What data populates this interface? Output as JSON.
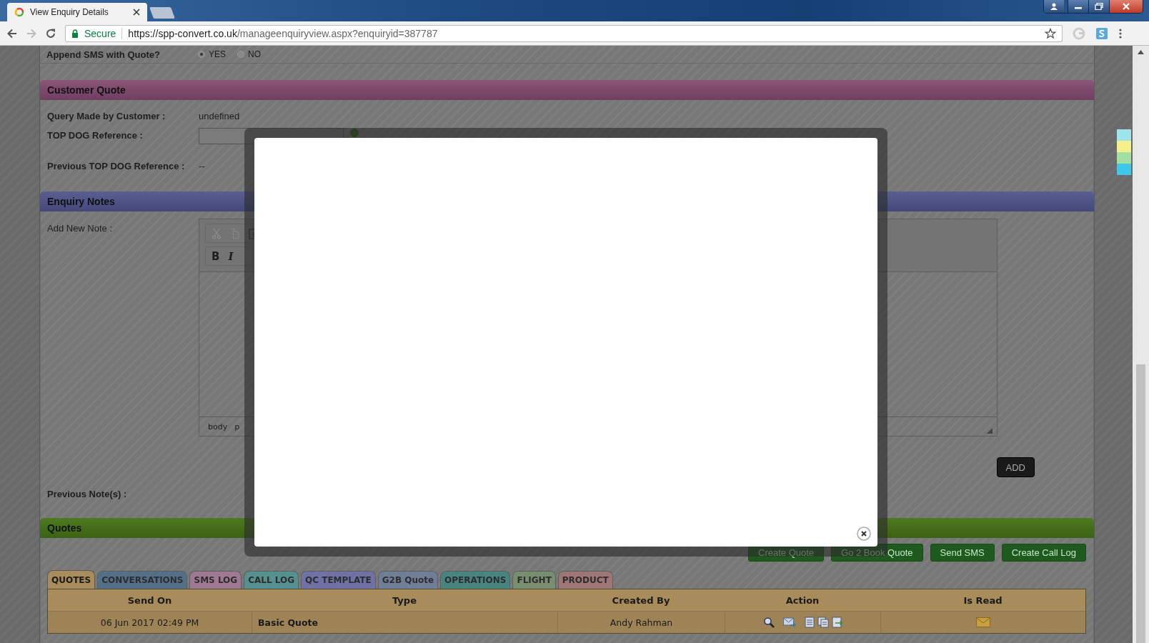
{
  "browser": {
    "tab_title": "View Enquiry Details",
    "secure_label": "Secure",
    "url_host": "https://spp-convert.co.uk",
    "url_path": "/manageenquiryview.aspx?enquiryid=387787"
  },
  "sms_option": {
    "label": "Append SMS with Quote?",
    "options": [
      {
        "label": "YES",
        "selected": true
      },
      {
        "label": "NO",
        "selected": false
      }
    ]
  },
  "customer_quote": {
    "title": "Customer Quote",
    "fields": [
      {
        "kind": "text",
        "label": "Query Made by Customer :",
        "value": "undefined"
      },
      {
        "kind": "input",
        "label": "TOP DOG Reference :"
      },
      {
        "kind": "text",
        "label": "Previous TOP DOG Reference :",
        "value": "--"
      }
    ]
  },
  "enquiry_notes": {
    "title": "Enquiry Notes",
    "add_label": "Add New Note :",
    "format_buttons": [
      "B",
      "I"
    ],
    "editor_path": [
      "body",
      "p"
    ],
    "add_button": "ADD",
    "previous_label": "Previous Note(s) :"
  },
  "quotes": {
    "title": "Quotes",
    "buttons": [
      "Create Quote",
      "Go 2 Book Quote",
      "Send SMS",
      "Create Call Log"
    ],
    "tabs": [
      {
        "label": "QUOTES",
        "selected": true,
        "color": "#a88c5c"
      },
      {
        "label": "CONVERSATIONS",
        "selected": false,
        "color": "#4b6d8c"
      },
      {
        "label": "SMS LOG",
        "selected": false,
        "color": "#a87a98"
      },
      {
        "label": "CALL LOG",
        "selected": false,
        "color": "#4b9896"
      },
      {
        "label": "QC TEMPLATE",
        "selected": false,
        "color": "#6e70b0"
      },
      {
        "label": "G2B Quote",
        "selected": false,
        "color": "#6e80a0"
      },
      {
        "label": "OPERATIONS",
        "selected": false,
        "color": "#3c8882"
      },
      {
        "label": "FLIGHT",
        "selected": false,
        "color": "#78946c"
      },
      {
        "label": "PRODUCT",
        "selected": false,
        "color": "#a87676"
      }
    ],
    "table": {
      "columns": [
        "Send On",
        "Type",
        "Created By",
        "Action",
        "Is Read"
      ],
      "rows": [
        {
          "send_on": "06 Jun 2017 02:49 PM",
          "type": "Basic Quote",
          "created_by": "Andy Rahman"
        }
      ]
    }
  }
}
